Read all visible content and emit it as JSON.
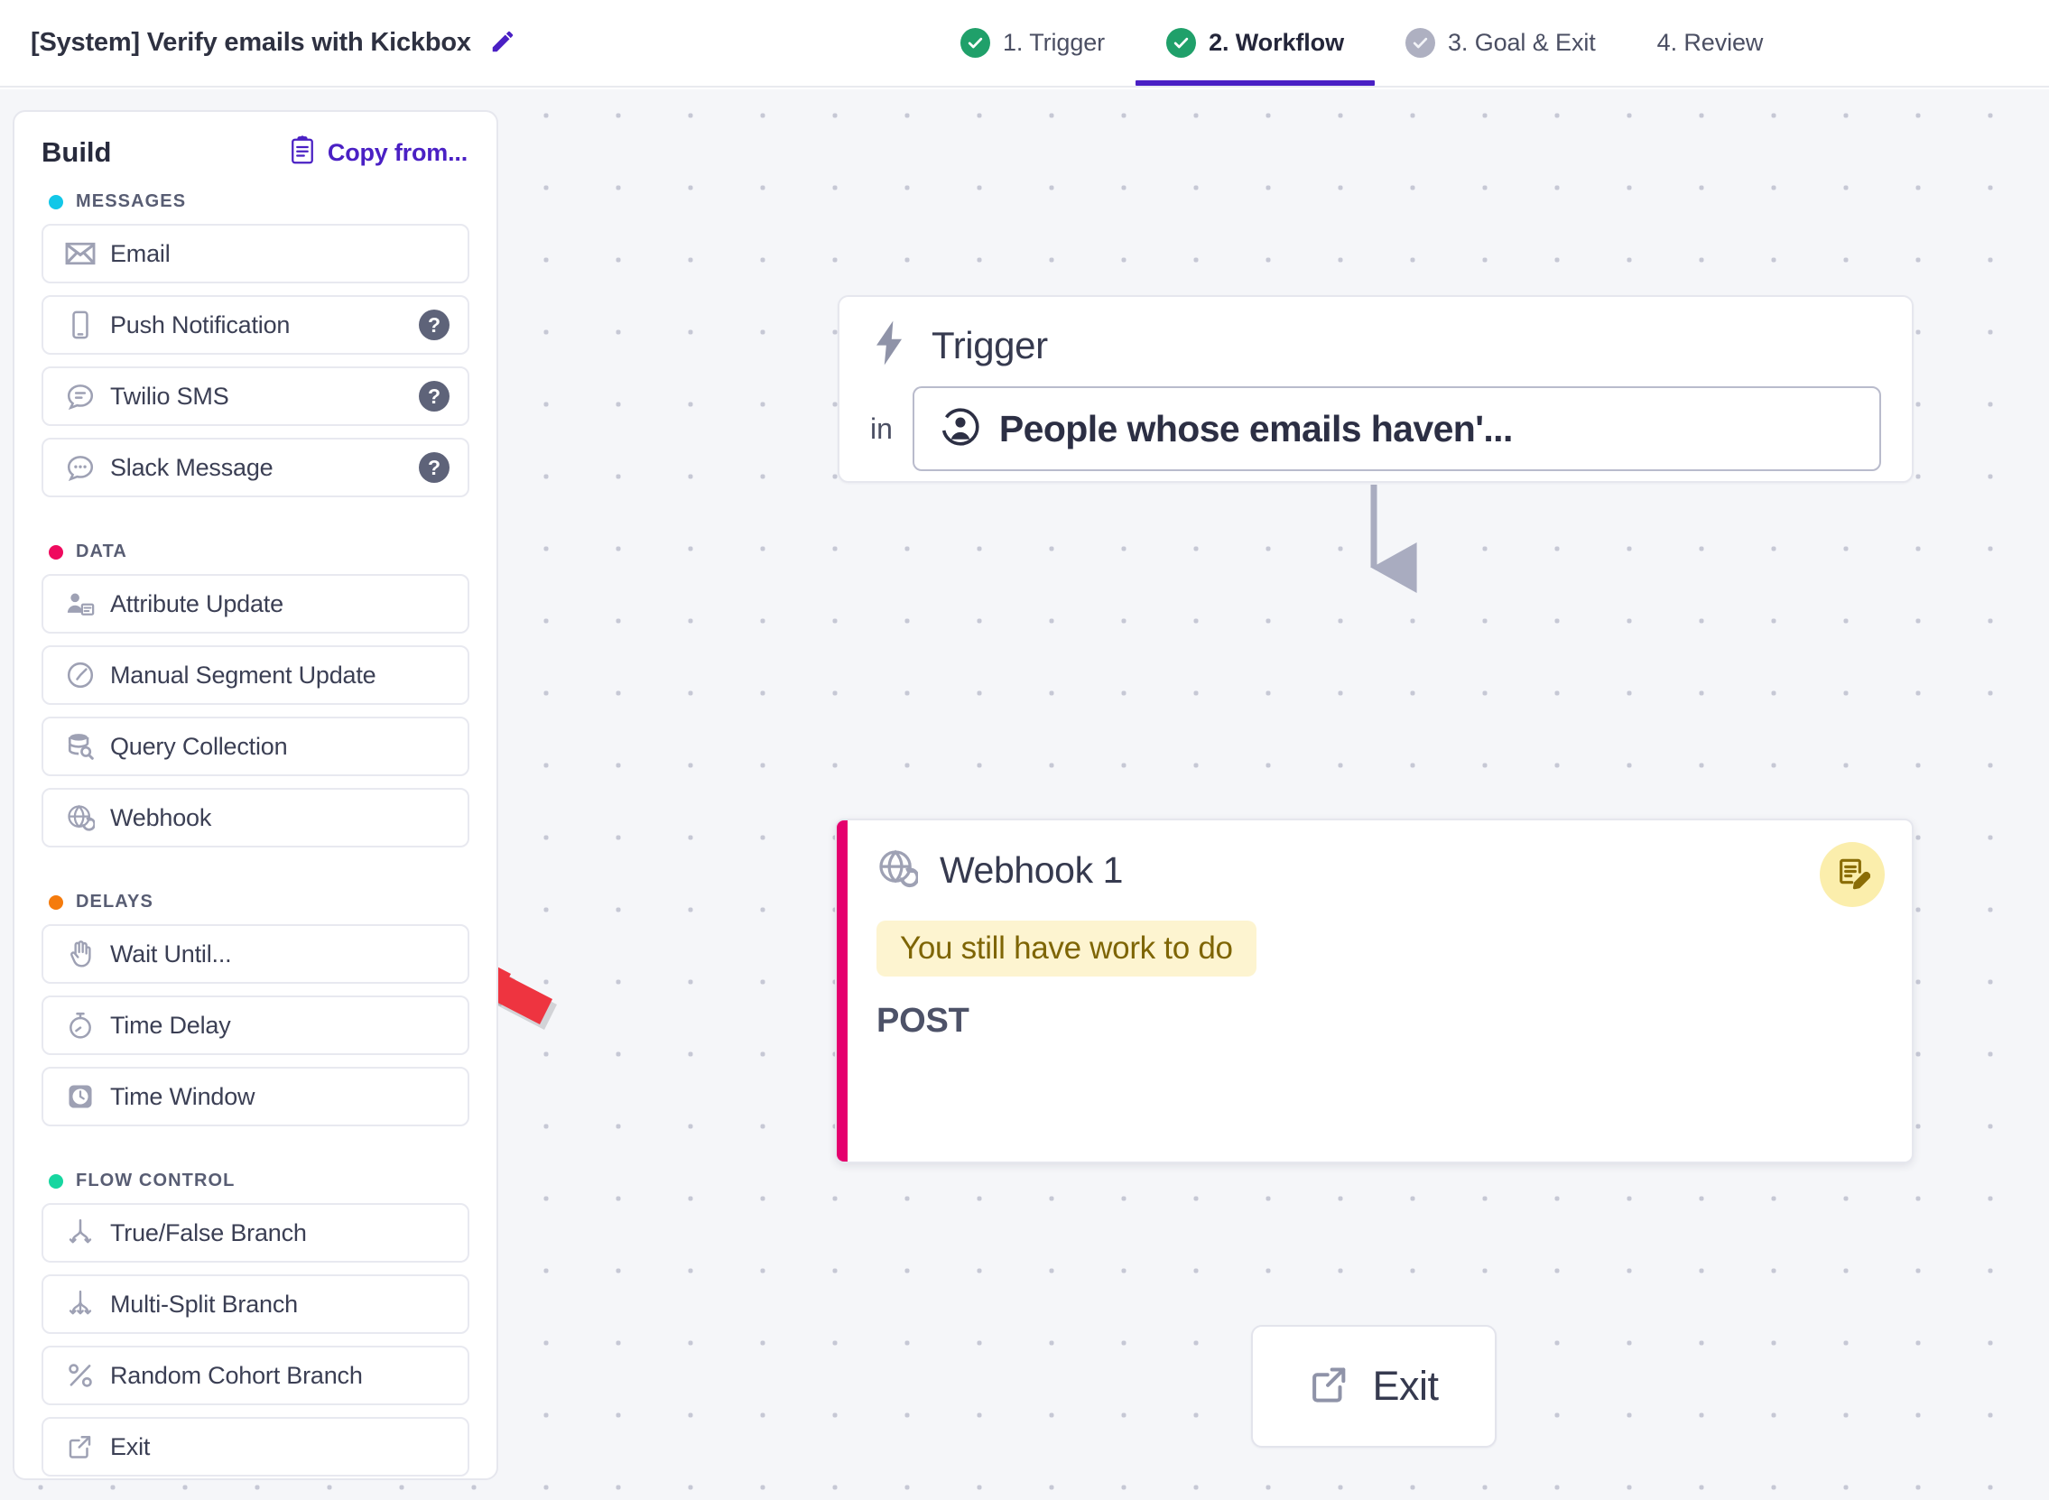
{
  "header": {
    "campaign_title": "[System] Verify emails with Kickbox",
    "edit_icon": "pencil-icon",
    "steps": [
      {
        "label": "1. Trigger",
        "state": "done",
        "icon": "check-circle-icon"
      },
      {
        "label": "2. Workflow",
        "state": "done",
        "icon": "check-circle-icon",
        "active": true
      },
      {
        "label": "3. Goal & Exit",
        "state": "pending",
        "icon": "check-circle-icon"
      },
      {
        "label": "4. Review",
        "state": "none",
        "icon": ""
      }
    ],
    "active_underline_color": "#4a20c4"
  },
  "sidebar": {
    "title": "Build",
    "copy_from_label": "Copy from...",
    "copy_from_icon": "clipboard-icon",
    "sections": [
      {
        "label": "MESSAGES",
        "dot_color": "#12c7e8",
        "items": [
          {
            "label": "Email",
            "icon": "envelope-icon",
            "help": false
          },
          {
            "label": "Push Notification",
            "icon": "mobile-phone-icon",
            "help": true
          },
          {
            "label": "Twilio SMS",
            "icon": "chat-bubble-lines-icon",
            "help": true
          },
          {
            "label": "Slack Message",
            "icon": "chat-bubble-dots-icon",
            "help": true
          }
        ]
      },
      {
        "label": "DATA",
        "dot_color": "#ef0a5e",
        "items": [
          {
            "label": "Attribute Update",
            "icon": "person-card-icon",
            "help": false
          },
          {
            "label": "Manual Segment Update",
            "icon": "segment-pie-icon",
            "help": false
          },
          {
            "label": "Query Collection",
            "icon": "database-search-icon",
            "help": false
          },
          {
            "label": "Webhook",
            "icon": "globe-refresh-icon",
            "help": false
          }
        ]
      },
      {
        "label": "DELAYS",
        "dot_color": "#f57b0c",
        "items": [
          {
            "label": "Wait Until...",
            "icon": "hand-raised-icon",
            "help": false
          },
          {
            "label": "Time Delay",
            "icon": "stopwatch-icon",
            "help": false
          },
          {
            "label": "Time Window",
            "icon": "clock-square-icon",
            "help": false
          }
        ]
      },
      {
        "label": "FLOW CONTROL",
        "dot_color": "#17d6a0",
        "items": [
          {
            "label": "True/False Branch",
            "icon": "branch-two-icon",
            "help": false
          },
          {
            "label": "Multi-Split Branch",
            "icon": "branch-multi-icon",
            "help": false
          },
          {
            "label": "Random Cohort Branch",
            "icon": "percent-icon",
            "help": false
          },
          {
            "label": "Exit",
            "icon": "external-link-icon",
            "help": false
          }
        ]
      }
    ],
    "help_glyph": "?"
  },
  "canvas": {
    "background_color": "#f5f6f9",
    "dot_color": "#c6c8d5",
    "trigger_node": {
      "title": "Trigger",
      "icon": "lightning-bolt-icon",
      "preposition": "in",
      "segment_label": "People whose emails haven'...",
      "segment_icon": "person-circle-icon"
    },
    "webhook_node": {
      "title": "Webhook 1",
      "icon": "globe-refresh-icon",
      "accent_color": "#e5006e",
      "warning_text": "You still have work to do",
      "warning_bg": "#fdf4d0",
      "warning_color": "#7e6504",
      "method": "POST",
      "badge_icon": "document-edit-icon",
      "badge_bg": "#fbeeac"
    },
    "exit_node": {
      "label": "Exit",
      "icon": "external-link-icon"
    },
    "annotation": {
      "type": "red-arrow",
      "color": "#ee3440",
      "points_to": "Webhook"
    }
  }
}
